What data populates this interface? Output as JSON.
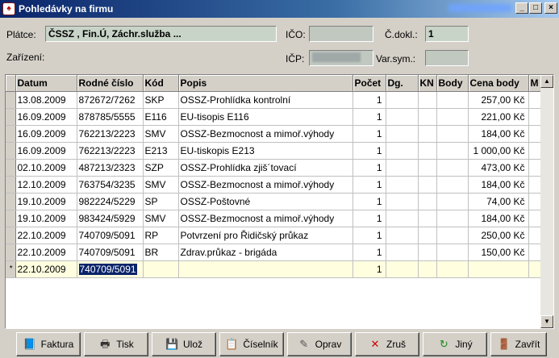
{
  "window": {
    "title": "Pohledávky na firmu",
    "minimize": "_",
    "maximize": "□",
    "close": "×"
  },
  "header": {
    "platce_label": "Plátce:",
    "platce_value": "ČSSZ ,    Fin.Ú,   Záchr.služba ...",
    "ico_label": "IČO:",
    "ico_value": "",
    "cdokl_label": "Č.dokl.:",
    "cdokl_value": "1",
    "zarizeni_label": "Zařízení:",
    "icp_label": "IČP:",
    "icp_value": "",
    "varsym_label": "Var.sym.:",
    "varsym_value": ""
  },
  "table": {
    "columns": [
      "Datum",
      "Rodné číslo",
      "Kód",
      "Popis",
      "Počet",
      "Dg.",
      "KN",
      "Body",
      "Cena body",
      "M"
    ],
    "rows": [
      [
        "13.08.2009",
        "872672/7262",
        "SKP",
        "OSSZ-Prohlídka kontrolní",
        "1",
        "",
        "",
        "",
        "257,00 Kč"
      ],
      [
        "16.09.2009",
        "878785/5555",
        "E116",
        "EU-tisopis E116",
        "1",
        "",
        "",
        "",
        "221,00 Kč"
      ],
      [
        "16.09.2009",
        "762213/2223",
        "SMV",
        "OSSZ-Bezmocnost a mimoř.výhody",
        "1",
        "",
        "",
        "",
        "184,00 Kč"
      ],
      [
        "16.09.2009",
        "762213/2223",
        "E213",
        "EU-tiskopis E213",
        "1",
        "",
        "",
        "",
        "1 000,00 Kč"
      ],
      [
        "02.10.2009",
        "487213/2323",
        "SZP",
        "OSSZ-Prohlídka zjiš´tovací",
        "1",
        "",
        "",
        "",
        "473,00 Kč"
      ],
      [
        "12.10.2009",
        "763754/3235",
        "SMV",
        "OSSZ-Bezmocnost a mimoř.výhody",
        "1",
        "",
        "",
        "",
        "184,00 Kč"
      ],
      [
        "19.10.2009",
        "982224/5229",
        "SP",
        "OSSZ-Poštovné",
        "1",
        "",
        "",
        "",
        "74,00 Kč"
      ],
      [
        "19.10.2009",
        "983424/5929",
        "SMV",
        "OSSZ-Bezmocnost a mimoř.výhody",
        "1",
        "",
        "",
        "",
        "184,00 Kč"
      ],
      [
        "22.10.2009",
        "740709/5091",
        "RP",
        "Potvrzení pro Řidičský průkaz",
        "1",
        "",
        "",
        "",
        "250,00 Kč"
      ],
      [
        "22.10.2009",
        "740709/5091",
        "BR",
        "Zdrav.průkaz  - brigáda",
        "1",
        "",
        "",
        "",
        "150,00 Kč"
      ]
    ],
    "new_row": {
      "marker": "*",
      "date": "22.10.2009",
      "rc": "740709/5091",
      "count": "1"
    }
  },
  "toolbar": [
    {
      "label": "Faktura",
      "icon": "book-icon",
      "u": "F"
    },
    {
      "label": "Tisk",
      "icon": "printer-icon",
      "u": "T"
    },
    {
      "label": "Ulož",
      "icon": "save-icon",
      "u": "l"
    },
    {
      "label": "Číselník",
      "icon": "list-icon",
      "u": "Č"
    },
    {
      "label": "Oprav",
      "icon": "edit-icon",
      "u": "O"
    },
    {
      "label": "Zruš",
      "icon": "cancel-icon",
      "u": "Z"
    },
    {
      "label": "Jiný",
      "icon": "refresh-icon",
      "u": "J"
    },
    {
      "label": "Zavřít",
      "icon": "door-icon",
      "u": "Z"
    }
  ]
}
